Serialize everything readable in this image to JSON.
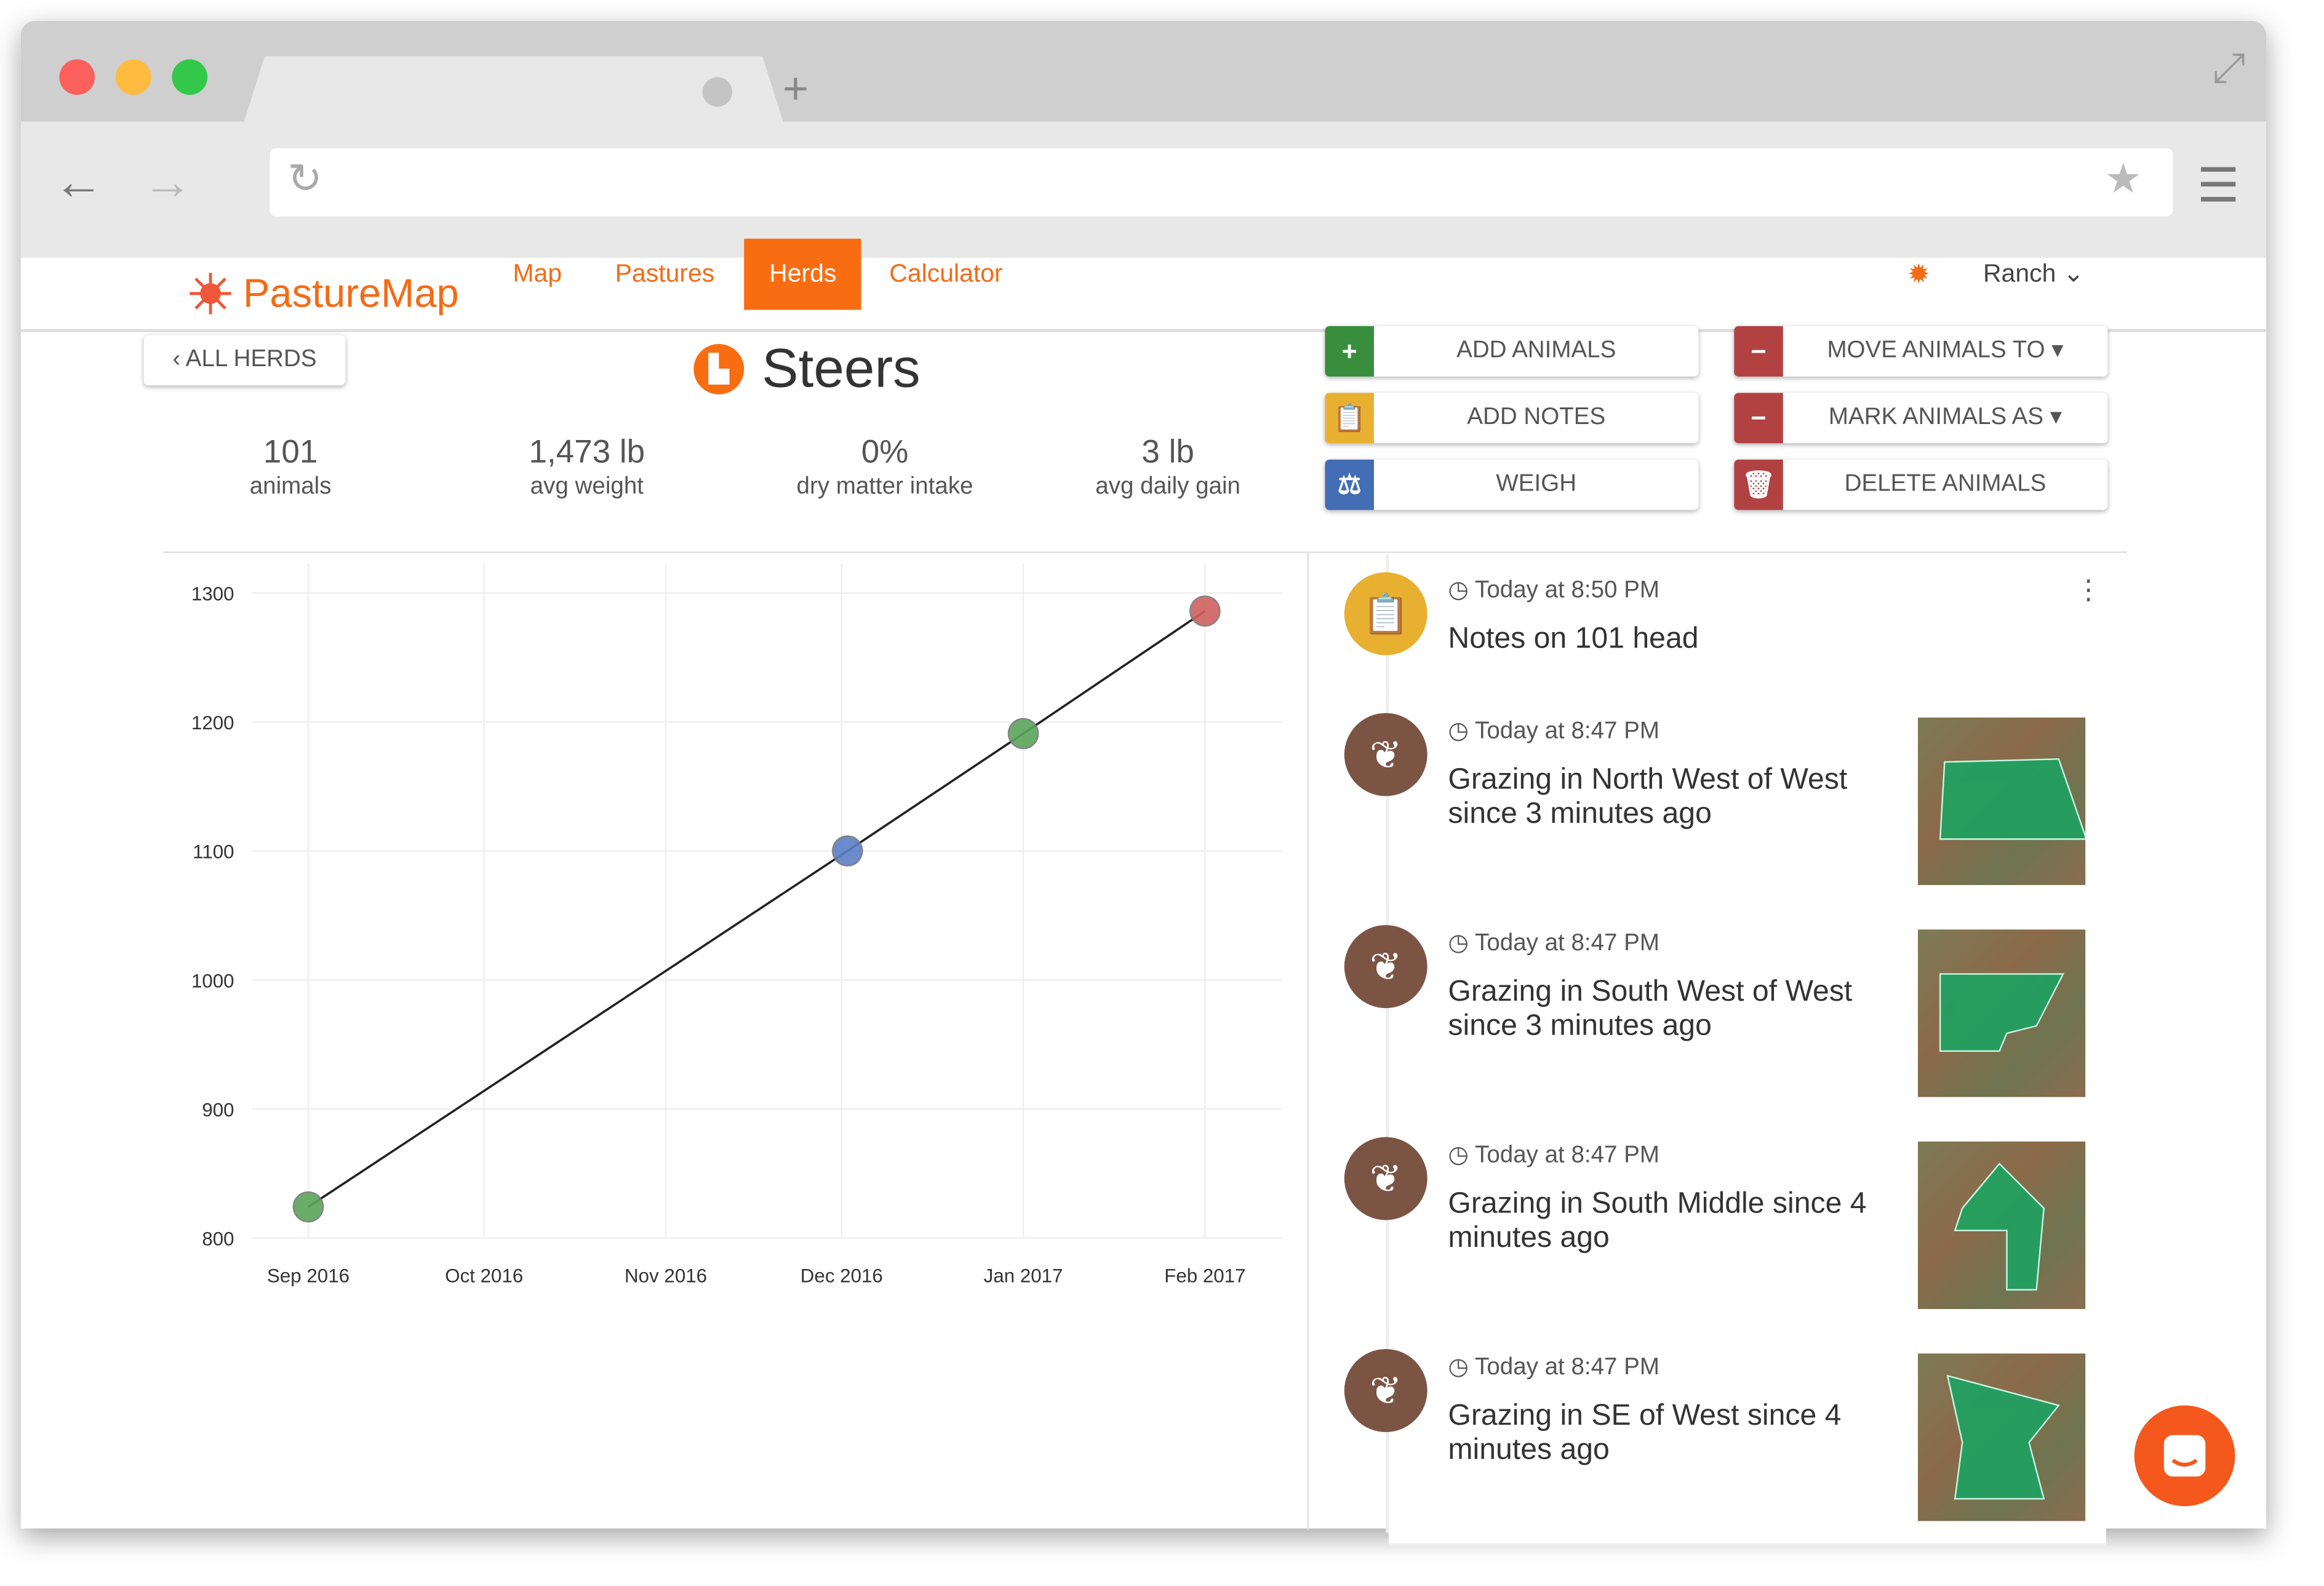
{
  "browser": {
    "new_tab": "+",
    "back": "←",
    "forward": "→",
    "reload": "↻",
    "bookmark": "★",
    "menu": "☰",
    "expand": "⤢"
  },
  "app": {
    "brand": "PastureMap",
    "nav": [
      {
        "label": "Map"
      },
      {
        "label": "Pastures"
      },
      {
        "label": "Herds",
        "active": true
      },
      {
        "label": "Calculator"
      }
    ],
    "ranch": "Ranch ⌄",
    "accent": "#f96d12"
  },
  "herd": {
    "back_label": "‹ ALL HERDS",
    "name": "Steers",
    "stats": [
      {
        "value": "101",
        "label": "animals"
      },
      {
        "value": "1,473 lb",
        "label": "avg weight"
      },
      {
        "value": "0%",
        "label": "dry matter intake"
      },
      {
        "value": "3 lb",
        "label": "avg daily gain"
      }
    ]
  },
  "actions": [
    {
      "label": "ADD ANIMALS",
      "icon": "plus-icon",
      "color": "#388e3c"
    },
    {
      "label": "MOVE ANIMALS TO ▾",
      "icon": "minus-icon",
      "color": "#b24242"
    },
    {
      "label": "ADD NOTES",
      "icon": "clipboard-icon",
      "color": "#e8b030"
    },
    {
      "label": "MARK ANIMALS AS ▾",
      "icon": "minus-icon",
      "color": "#b24242"
    },
    {
      "label": "WEIGH",
      "icon": "scale-icon",
      "color": "#436db5"
    },
    {
      "label": "DELETE ANIMALS",
      "icon": "trash-icon",
      "color": "#b24242"
    }
  ],
  "chart_data": {
    "type": "line",
    "x_ticks": [
      "Sep 2016",
      "Oct 2016",
      "Nov 2016",
      "Dec 2016",
      "Jan 2017",
      "Feb 2017"
    ],
    "y_ticks": [
      800,
      900,
      1000,
      1100,
      1200,
      1300
    ],
    "ylim": [
      800,
      1300
    ],
    "grid": true,
    "points": [
      {
        "x": "2016-09-01",
        "y": 824,
        "color": "#5aa55a"
      },
      {
        "x": "2016-12-02",
        "y": 1100,
        "color": "#5b7fc7"
      },
      {
        "x": "2017-01-01",
        "y": 1191,
        "color": "#5aa55a"
      },
      {
        "x": "2017-02-01",
        "y": 1286,
        "color": "#d06060"
      }
    ]
  },
  "feed": [
    {
      "time": "Today at 8:50 PM",
      "text": "Notes on 101 head",
      "icon": "clipboard-icon",
      "color": "#e8b030"
    },
    {
      "time": "Today at 8:47 PM",
      "text": "Grazing in North West of West since 3 minutes ago",
      "icon": "leaf-icon",
      "color": "#7b5444"
    },
    {
      "time": "Today at 8:47 PM",
      "text": "Grazing in South West of West since 3 minutes ago",
      "icon": "leaf-icon",
      "color": "#7b5444"
    },
    {
      "time": "Today at 8:47 PM",
      "text": "Grazing in South Middle since 4 minutes ago",
      "icon": "leaf-icon",
      "color": "#7b5444"
    },
    {
      "time": "Today at 8:47 PM",
      "text": "Grazing in SE of West since 4 minutes ago",
      "icon": "leaf-icon",
      "color": "#7b5444"
    }
  ]
}
